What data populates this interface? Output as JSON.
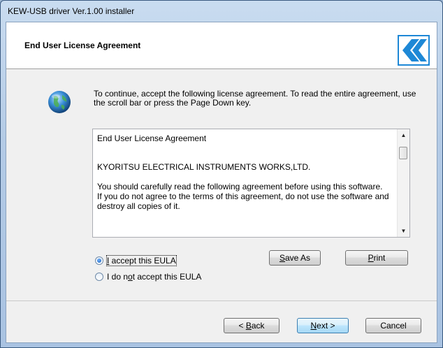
{
  "window": {
    "title": "KEW-USB driver Ver.1.00 installer"
  },
  "header": {
    "heading": "End User License Agreement"
  },
  "intro": {
    "text": "To continue, accept the following license agreement. To read the entire agreement, use the scroll bar or press the Page Down key."
  },
  "eula": {
    "title": "End User License Agreement",
    "company": "KYORITSU ELECTRICAL INSTRUMENTS WORKS,LTD.",
    "para1": "You should carefully read the following agreement before using this software.",
    "para2": "If you do not agree to the terms of this agreement, do not use the software and destroy all copies of it."
  },
  "options": {
    "accept": {
      "prefix": "",
      "mnemonic": "I",
      "suffix": " accept this EULA",
      "checked": true
    },
    "decline": {
      "prefix": "I do n",
      "mnemonic": "o",
      "suffix": "t accept this EULA",
      "checked": false
    }
  },
  "buttons": {
    "save_as": {
      "mnemonic": "S",
      "rest": "ave As"
    },
    "print": {
      "mnemonic": "P",
      "rest": "rint"
    },
    "back": {
      "prefix": "< ",
      "mnemonic": "B",
      "rest": "ack"
    },
    "next": {
      "mnemonic": "N",
      "rest": "ext >"
    },
    "cancel": "Cancel"
  },
  "colors": {
    "logo_blue": "#1e88d6",
    "title_gradient_top": "#c9dcf0"
  },
  "icons": {
    "intro": "globe-icon",
    "logo": "kyoritsu-logo"
  }
}
